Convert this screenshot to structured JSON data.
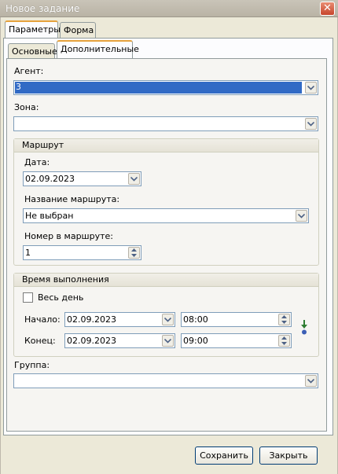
{
  "window": {
    "title": "Новое задание",
    "close_icon": "close-icon"
  },
  "top_tabs": [
    "Параметры",
    "Форма"
  ],
  "sub_tabs": [
    "Основные",
    "Дополнительные"
  ],
  "agent": {
    "label": "Агент:",
    "value": "3"
  },
  "zone": {
    "label": "Зона:",
    "value": ""
  },
  "route_group": {
    "title": "Маршрут",
    "date_label": "Дата:",
    "date_value": "02.09.2023",
    "route_name_label": "Название маршрута:",
    "route_name_value": "Не выбран",
    "route_number_label": "Номер в маршруте:",
    "route_number_value": "1"
  },
  "time_group": {
    "title": "Время выполнения",
    "all_day_label": "Весь день",
    "all_day_checked": false,
    "start_label": "Начало:",
    "start_date": "02.09.2023",
    "start_time": "08:00",
    "end_label": "Конец:",
    "end_date": "02.09.2023",
    "end_time": "09:00"
  },
  "group": {
    "label": "Группа:",
    "value": ""
  },
  "buttons": {
    "save": "Сохранить",
    "close": "Закрыть"
  },
  "colors": {
    "selection": "#316ac5",
    "tab_accent": "#e6a23c",
    "input_border": "#7f9db9"
  }
}
